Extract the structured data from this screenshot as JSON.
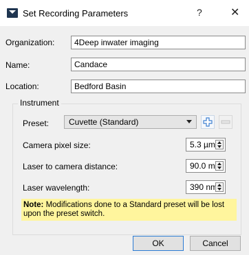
{
  "window": {
    "title": "Set Recording Parameters",
    "help_label": "?",
    "close_label": "✕"
  },
  "fields": {
    "organization": {
      "label": "Organization:",
      "value": "4Deep inwater imaging"
    },
    "name": {
      "label": "Name:",
      "value": "Candace"
    },
    "location": {
      "label": "Location:",
      "value": "Bedford Basin"
    }
  },
  "instrument": {
    "group_title": "Instrument",
    "preset": {
      "label": "Preset:",
      "value": "Cuvette (Standard)"
    },
    "camera_pixel_size": {
      "label": "Camera pixel size:",
      "value": "5.3 µm"
    },
    "laser_to_camera_distance": {
      "label": "Laser to camera distance:",
      "value": "90.0 mm"
    },
    "laser_wavelength": {
      "label": "Laser wavelength:",
      "value": "390 nm"
    }
  },
  "note": {
    "bold": "Note:",
    "text": " Modifications done to a Standard preset will be lost upon the preset switch."
  },
  "buttons": {
    "ok": "OK",
    "cancel": "Cancel"
  },
  "icons": {
    "app": "dialog-app-icon",
    "add": "plus-icon",
    "remove": "minus-icon"
  },
  "colors": {
    "note_bg": "#fff59d",
    "accent": "#2a7bd4"
  }
}
